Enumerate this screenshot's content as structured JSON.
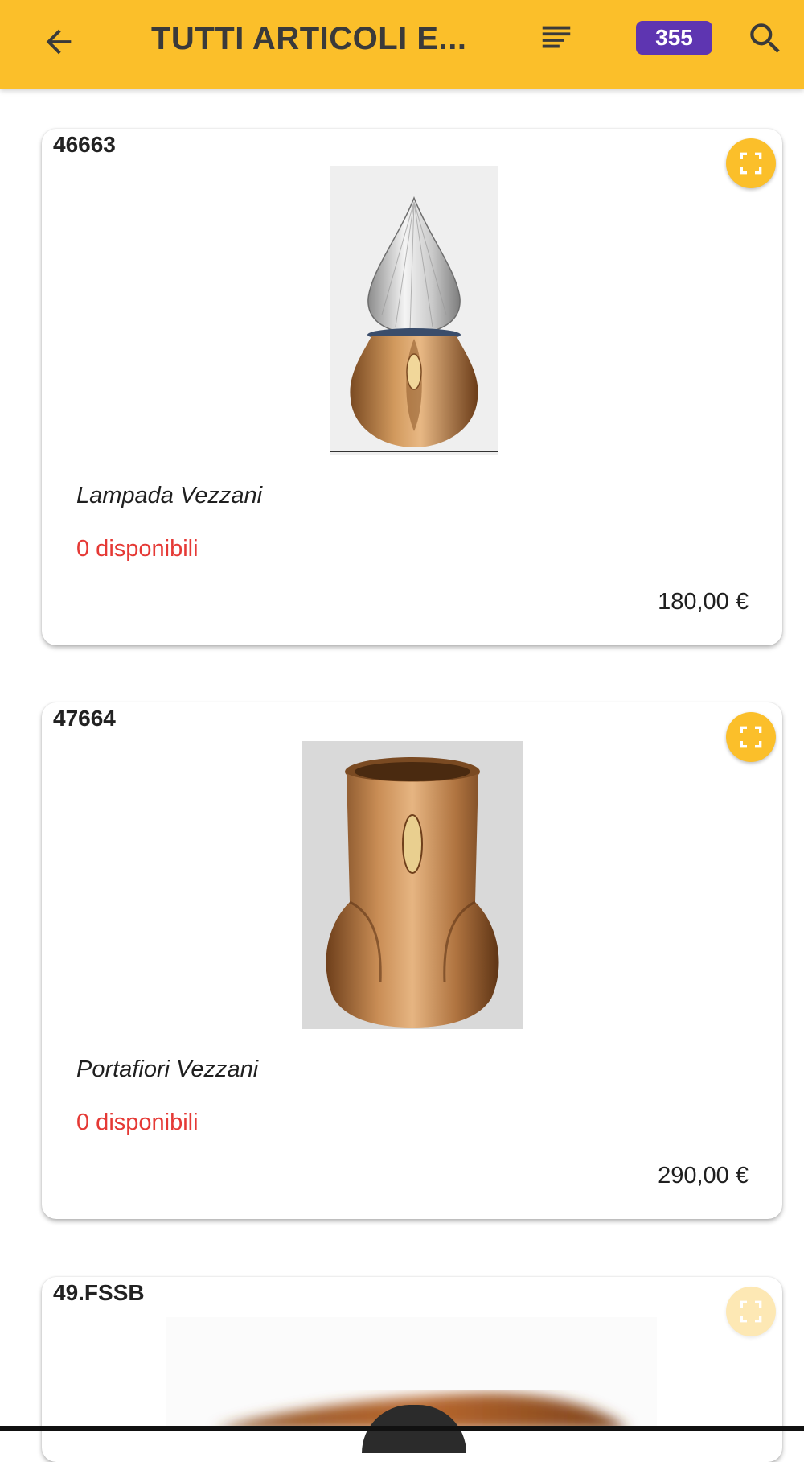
{
  "header": {
    "title": "TUTTI ARTICOLI E...",
    "count_badge": "355",
    "icons": {
      "back": "arrow-back-icon",
      "sort": "sort-lines-icon",
      "search": "search-icon"
    },
    "color": "#FBBF2A",
    "badge_color": "#5E35B1"
  },
  "products": [
    {
      "code": "46663",
      "name": "Lampada Vezzani",
      "availability": "0 disponibili",
      "price": "180,00 €",
      "image": "bronze-lamp-with-glass-flame"
    },
    {
      "code": "47664",
      "name": "Portafiori Vezzani",
      "availability": "0 disponibili",
      "price": "290,00 €",
      "image": "bronze-flower-vase"
    },
    {
      "code": "49.FSSB",
      "image": "bronze-item-partially-visible"
    }
  ],
  "colors": {
    "availability_text": "#E53935",
    "expand_button": "#FBBF2A"
  }
}
